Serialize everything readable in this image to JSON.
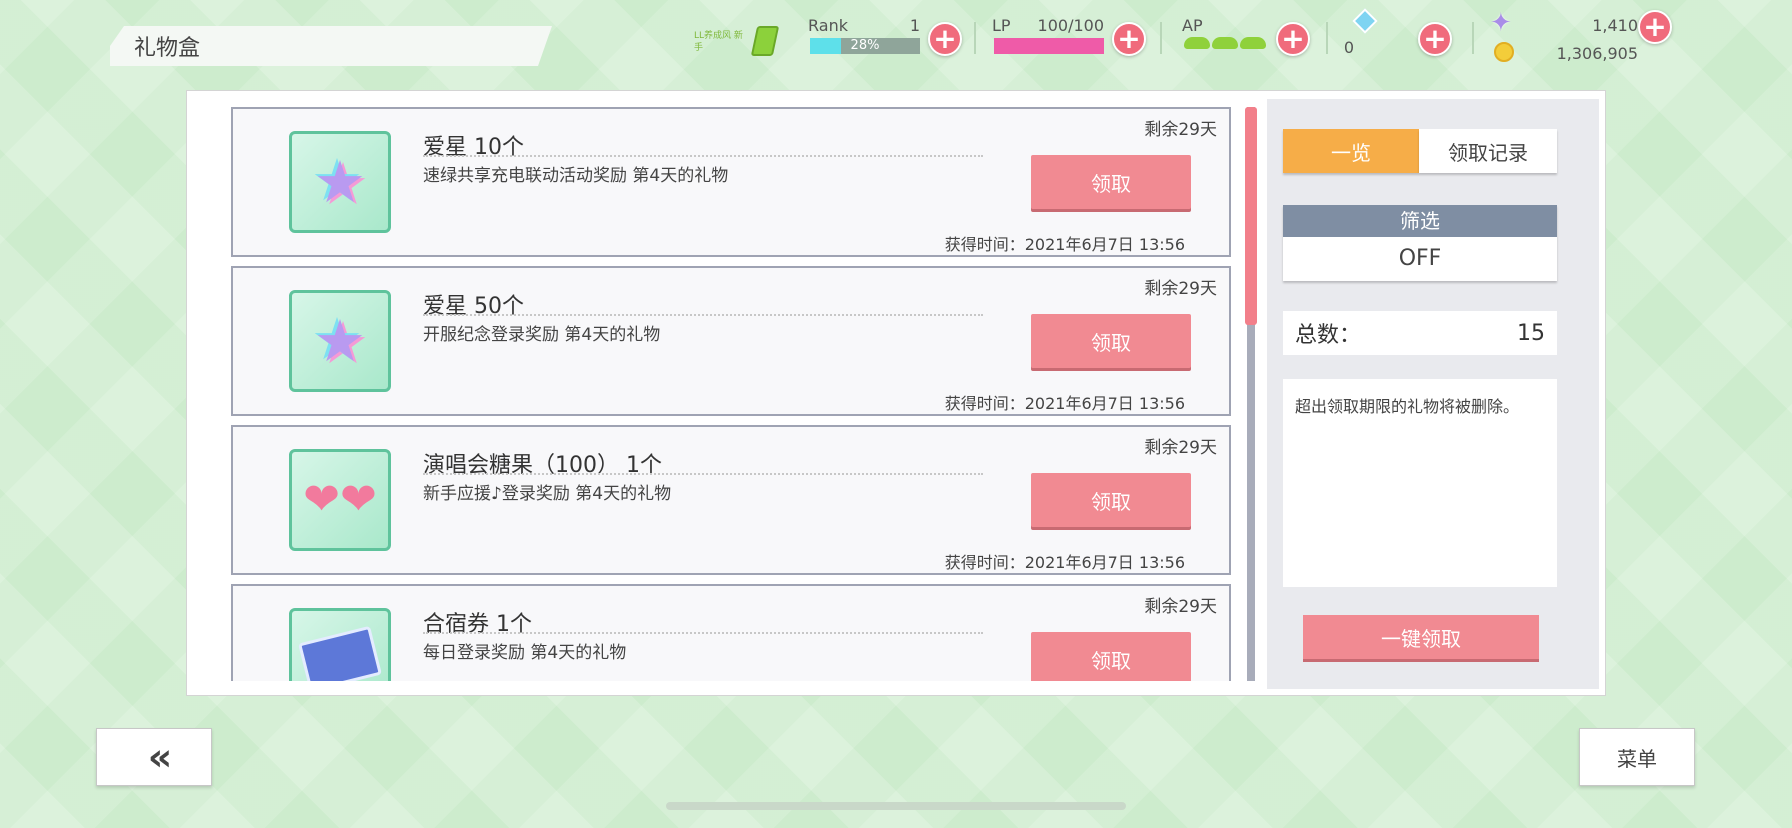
{
  "title": "礼物盒",
  "hud": {
    "badge_text": "LL养成风 新手",
    "rank_label": "Rank",
    "rank_value": "1",
    "rank_progress": "28%",
    "lp_label": "LP",
    "lp_value": "100/100",
    "ap_label": "AP",
    "gems": "0",
    "stars": "1,410",
    "coins": "1,306,905",
    "plus": "+"
  },
  "gifts": [
    {
      "title": "爱星 10个",
      "desc": "速绿共享充电联动活动奖励 第4天的礼物",
      "remaining": "剩余29天",
      "button": "领取",
      "time": "获得时间：2021年6月7日 13:56",
      "icon": "star-gem-icon"
    },
    {
      "title": "爱星 50个",
      "desc": "开服纪念登录奖励 第4天的礼物",
      "remaining": "剩余29天",
      "button": "领取",
      "time": "获得时间：2021年6月7日 13:56",
      "icon": "star-gem-icon"
    },
    {
      "title": "演唱会糖果（100） 1个",
      "desc": "新手应援♪登录奖励 第4天的礼物",
      "remaining": "剩余29天",
      "button": "领取",
      "time": "获得时间：2021年6月7日 13:56",
      "icon": "candy-icon"
    },
    {
      "title": "合宿券 1个",
      "desc": "每日登录奖励 第4天的礼物",
      "remaining": "剩余29天",
      "button": "领取",
      "time": "",
      "icon": "ticket-icon"
    }
  ],
  "side": {
    "tab_overview": "一览",
    "tab_history": "领取记录",
    "filter_label": "筛选",
    "filter_value": "OFF",
    "total_label": "总数：",
    "total_value": "15",
    "notice": "超出领取期限的礼物将被删除。",
    "claim_all": "一键领取"
  },
  "bottom": {
    "back": "«",
    "menu": "菜单"
  },
  "colors": {
    "accent_pink": "#f18a92",
    "tab_orange": "#f6ad48",
    "background": "#cdeccd"
  }
}
